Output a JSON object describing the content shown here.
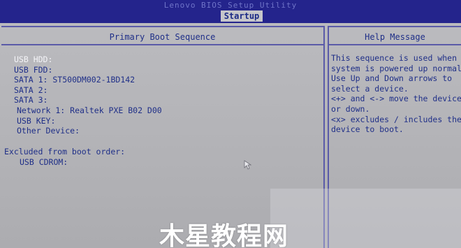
{
  "window": {
    "utility_title": "Lenovo BIOS Setup Utility",
    "active_tab": "Startup"
  },
  "primary_boot": {
    "header": "Primary Boot Sequence",
    "items": [
      "USB HDD:",
      "USB FDD:",
      "SATA 1: ST500DM002-1BD142",
      "SATA 2:",
      "SATA 3:",
      "Network 1: Realtek PXE B02 D00",
      "USB KEY:",
      "Other Device:"
    ],
    "selected_index": 0,
    "excluded_label": "Excluded from boot order:",
    "excluded_items": [
      "USB CDROM:"
    ]
  },
  "help": {
    "header": "Help Message",
    "lines": [
      "This sequence is used when",
      "system is powered up normally.",
      "Use Up and Down arrows to",
      "select a device.",
      "<+> and <-> move the device up",
      "or down.",
      "<x> excludes / includes the",
      "device to boot."
    ]
  },
  "watermark": "木星教程网",
  "colors": {
    "top_bar": "#24248c",
    "panel_bg": "#b9b9bd",
    "text": "#1f2f88",
    "selected_text": "#f4f4f8"
  }
}
